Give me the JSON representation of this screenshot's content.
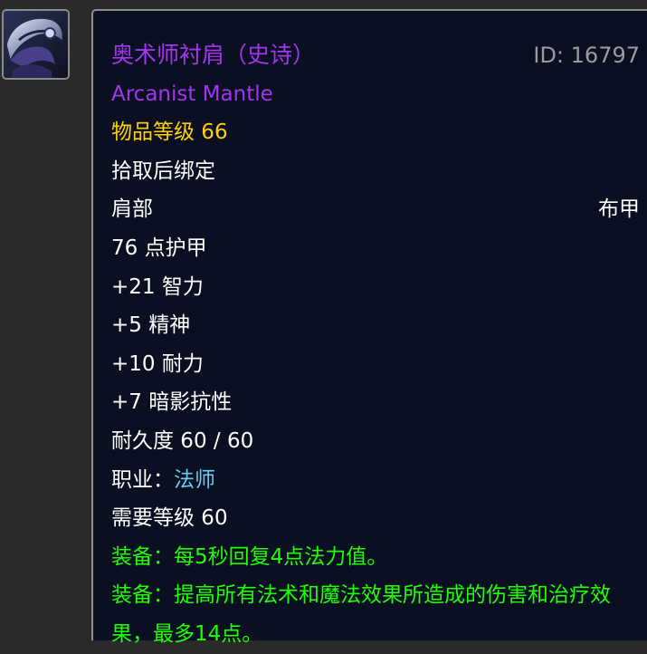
{
  "item": {
    "name_cn": "奥术师衬肩（史诗）",
    "id_label": "ID: 16797",
    "name_en": "Arcanist Mantle",
    "item_level": "物品等级 66",
    "binding": "拾取后绑定",
    "slot": "肩部",
    "armor_type": "布甲",
    "armor": "76 点护甲",
    "stats": [
      "+21 智力",
      "+5 精神",
      "+10 耐力",
      "+7 暗影抗性"
    ],
    "durability": "耐久度 60 / 60",
    "class_label": "职业：",
    "class_value": "法师",
    "required_level": "需要等级 60",
    "equip_effects": [
      "装备：每5秒回复4点法力值。",
      "装备：提高所有法术和魔法效果所造成的伤害和治疗效果，最多14点。"
    ]
  },
  "colors": {
    "epic": "#a335ee",
    "item_level": "#ffd100",
    "class": "#69ccf0",
    "equip": "#1eff00",
    "tooltip_bg": "#0b0f22"
  },
  "icon": "arcanist-mantle-shoulder-icon"
}
